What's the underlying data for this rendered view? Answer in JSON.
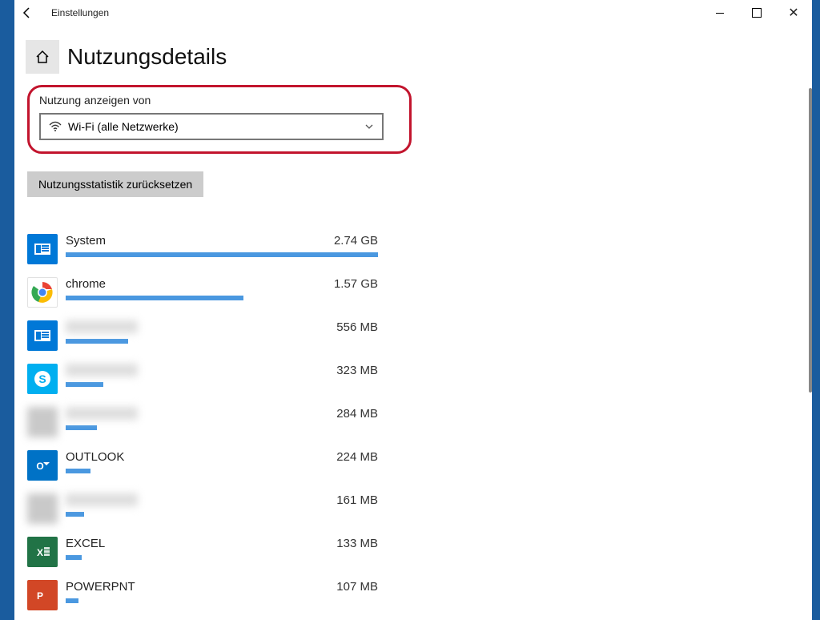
{
  "window": {
    "title": "Einstellungen"
  },
  "page": {
    "title": "Nutzungsdetails"
  },
  "dropdown": {
    "label": "Nutzung anzeigen von",
    "value": "Wi-Fi (alle Netzwerke)"
  },
  "buttons": {
    "reset": "Nutzungsstatistik zurücksetzen"
  },
  "apps": [
    {
      "name": "System",
      "amount": "2.74 GB",
      "bar": 100,
      "icon": "system",
      "blur": false
    },
    {
      "name": "chrome",
      "amount": "1.57 GB",
      "bar": 57,
      "icon": "chrome",
      "blur": false
    },
    {
      "name": "App",
      "amount": "556 MB",
      "bar": 20,
      "icon": "system",
      "blur": true
    },
    {
      "name": "App",
      "amount": "323 MB",
      "bar": 12,
      "icon": "skype",
      "blur": true
    },
    {
      "name": "App",
      "amount": "284 MB",
      "bar": 10,
      "icon": "blur",
      "blur": true
    },
    {
      "name": "OUTLOOK",
      "amount": "224 MB",
      "bar": 8,
      "icon": "outlook",
      "blur": false
    },
    {
      "name": "App",
      "amount": "161 MB",
      "bar": 6,
      "icon": "blur",
      "blur": true
    },
    {
      "name": "EXCEL",
      "amount": "133 MB",
      "bar": 5,
      "icon": "excel",
      "blur": false
    },
    {
      "name": "POWERPNT",
      "amount": "107 MB",
      "bar": 4,
      "icon": "powerpnt",
      "blur": false
    }
  ]
}
